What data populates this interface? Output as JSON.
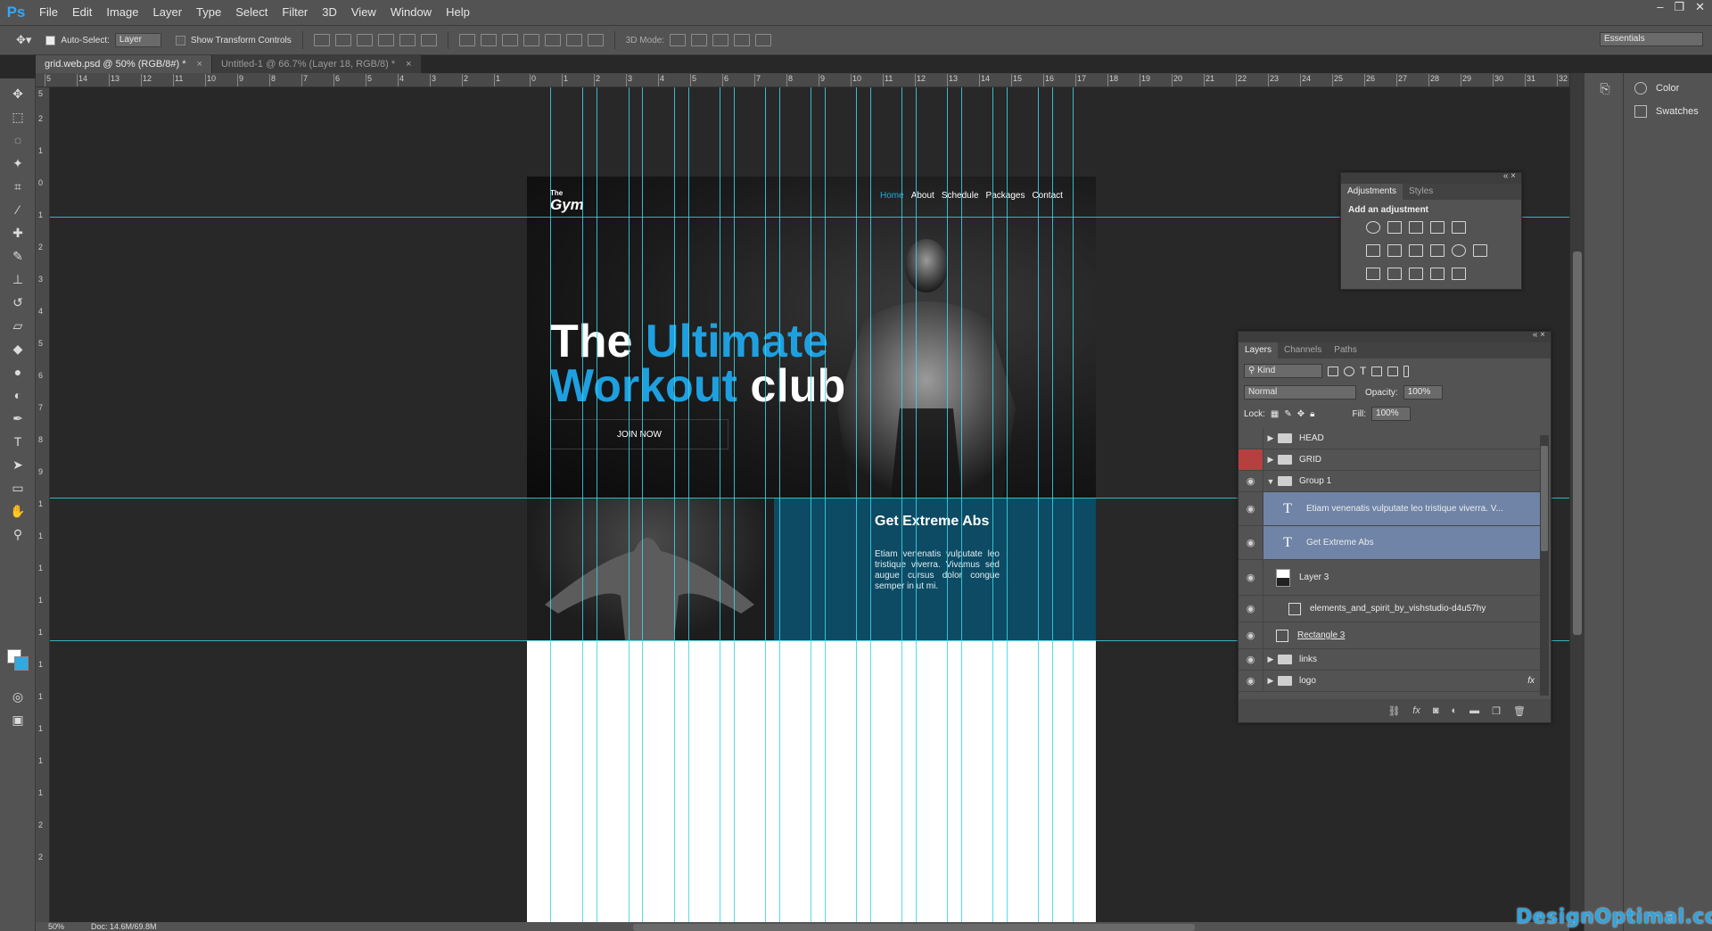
{
  "app": {
    "logo": "Ps"
  },
  "menu": [
    "File",
    "Edit",
    "Image",
    "Layer",
    "Type",
    "Select",
    "Filter",
    "3D",
    "View",
    "Window",
    "Help"
  ],
  "window_controls": [
    "–",
    "❐",
    "✕"
  ],
  "options": {
    "auto_select_label": "Auto-Select:",
    "auto_select_value": "Layer",
    "show_transform_label": "Show Transform Controls",
    "mode_3d_label": "3D Mode:",
    "workspace": "Essentials"
  },
  "tabs": [
    {
      "label": "grid.web.psd @ 50% (RGB/8#) *",
      "active": true
    },
    {
      "label": "Untitled-1 @ 66.7% (Layer 18, RGB/8) *",
      "active": false
    }
  ],
  "ruler_top": [
    "5",
    "14",
    "13",
    "12",
    "11",
    "10",
    "9",
    "8",
    "7",
    "6",
    "5",
    "4",
    "3",
    "2",
    "1",
    "0",
    "1",
    "2",
    "3",
    "4",
    "5",
    "6",
    "7",
    "8",
    "9",
    "10",
    "11",
    "12",
    "13",
    "14",
    "15",
    "16",
    "17",
    "18",
    "19",
    "20",
    "21",
    "22",
    "23",
    "24",
    "25",
    "26",
    "27",
    "28",
    "29",
    "30",
    "31",
    "32"
  ],
  "ruler_left": [
    "5",
    "2",
    "1",
    "0",
    "1",
    "2",
    "3",
    "4",
    "5",
    "6",
    "7",
    "8",
    "9",
    "1",
    "1",
    "1",
    "1",
    "1",
    "1",
    "1",
    "1",
    "1",
    "1",
    "2",
    "2"
  ],
  "website": {
    "logo_small": "The",
    "logo_big": "Gym",
    "nav": [
      "Home",
      "About",
      "Schedule",
      "Packages",
      "Contact"
    ],
    "headline_white_1": "The ",
    "headline_blue_1": "Ultimate",
    "headline_blue_2": "Workout",
    "headline_white_2": " club",
    "cta": "JOIN NOW",
    "feature_title": "Get Extreme Abs",
    "feature_body": "Etiam venenatis vulputate leo tristique viverra. Vivamus sed augue cursus dolor congue semper in ut mi."
  },
  "statusbar": {
    "zoom": "50%",
    "doc": "Doc: 14.6M/69.8M"
  },
  "dock": {
    "color_label": "Color",
    "swatches_label": "Swatches"
  },
  "adjustments": {
    "tab_adjustments": "Adjustments",
    "tab_styles": "Styles",
    "title": "Add an adjustment"
  },
  "layers": {
    "tab_layers": "Layers",
    "tab_channels": "Channels",
    "tab_paths": "Paths",
    "kind": "Kind",
    "blend": "Normal",
    "opacity_label": "Opacity:",
    "opacity": "100%",
    "lock_label": "Lock:",
    "fill_label": "Fill:",
    "fill": "100%",
    "items": [
      {
        "name": "HEAD"
      },
      {
        "name": "GRID"
      },
      {
        "name": "Group 1"
      },
      {
        "name": "Etiam venenatis vulputate leo tristique viverra. V..."
      },
      {
        "name": "Get Extreme Abs"
      },
      {
        "name": "Layer 3"
      },
      {
        "name": "elements_and_spirit_by_vishstudio-d4u57hy"
      },
      {
        "name": "Rectangle 3"
      },
      {
        "name": "links"
      },
      {
        "name": "logo"
      }
    ],
    "fx_label": "fx"
  },
  "watermark": "DesignOptimal.com",
  "colors": {
    "accent": "#1ea0e0",
    "guide": "#3ad6e8",
    "panel": "#0d4a63"
  }
}
